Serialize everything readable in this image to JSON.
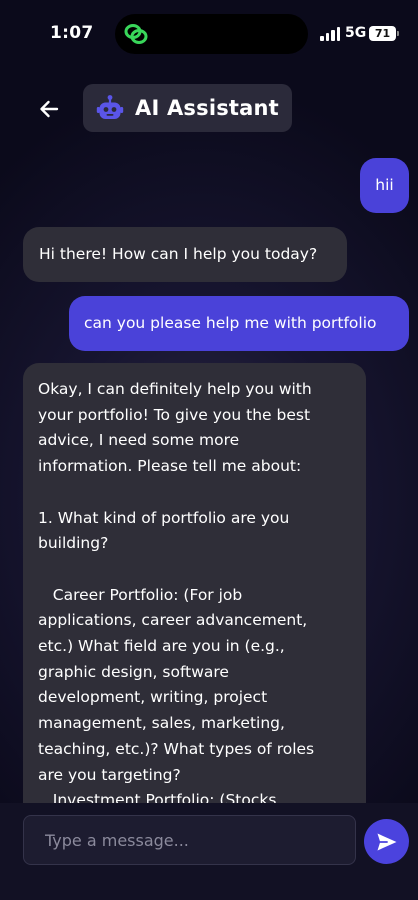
{
  "status_bar": {
    "time": "1:07",
    "network": "5G",
    "battery": "71"
  },
  "header": {
    "title": "AI Assistant",
    "back_icon": "arrow-left-icon",
    "title_icon": "robot-icon"
  },
  "messages": [
    {
      "role": "user",
      "text": "hii"
    },
    {
      "role": "assistant",
      "text": "Hi there! How can I help you today?"
    },
    {
      "role": "user",
      "text": "can you please help me with portfolio"
    },
    {
      "role": "assistant",
      "text": "Okay, I can definitely help you with\nyour portfolio! To give you the best\nadvice, I need some more\ninformation. Please tell me about:\n\n1. What kind of portfolio are you\nbuilding?\n\n   Career Portfolio: (For job\napplications, career advancement,\netc.) What field are you in (e.g.,\ngraphic design, software\ndevelopment, writing, project\nmanagement, sales, marketing,\nteaching, etc.)? What types of roles\nare you targeting?\n   Investment Portfolio: (Stocks,"
    }
  ],
  "composer": {
    "placeholder": "Type a message...",
    "value": "",
    "send_icon": "send-icon"
  },
  "colors": {
    "user_bubble": "#4a42d9",
    "assistant_bubble": "#2f2e38",
    "accent": "#4b43de",
    "background": "#171530"
  }
}
